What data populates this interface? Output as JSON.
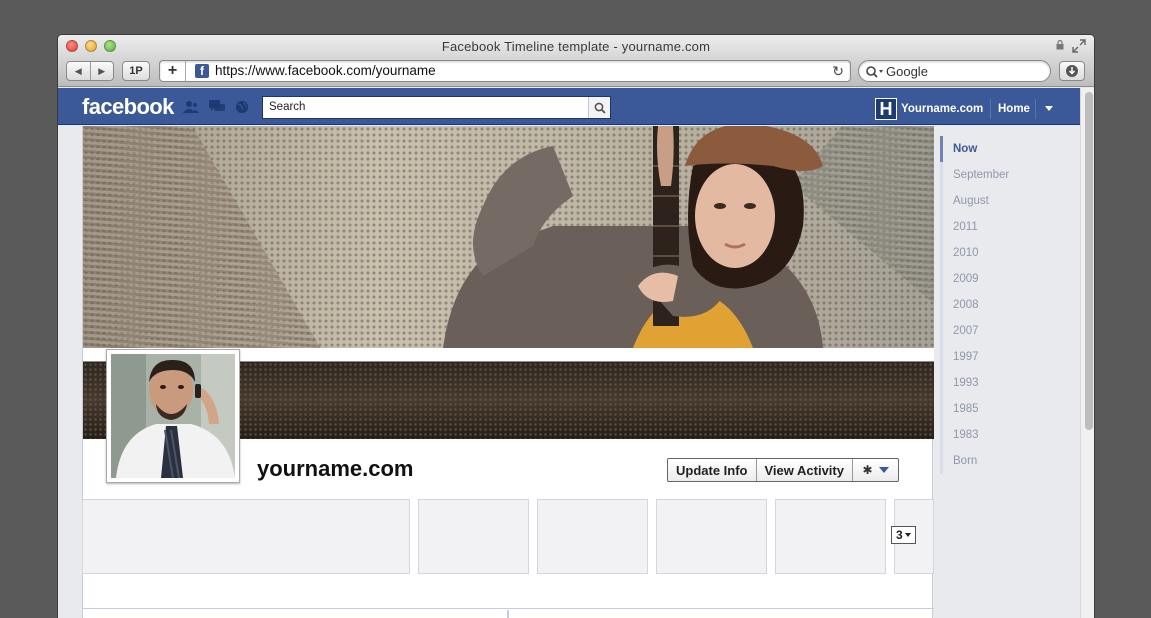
{
  "window": {
    "title": "Facebook Timeline template - yourname.com"
  },
  "browser": {
    "back_icon": "triangle-left-icon",
    "forward_icon": "triangle-right-icon",
    "extension_label": "1P",
    "add_label": "+",
    "url": "https://www.facebook.com/yourname",
    "reload_glyph": "↻",
    "search_engine": "Google"
  },
  "fb_header": {
    "logo": "facebook",
    "search_placeholder": "Search",
    "profile_icon_letter": "H",
    "profile_name": "Yourname.com",
    "home_label": "Home",
    "brand_color": "#3b5998"
  },
  "profile": {
    "name": "yourname.com",
    "actions": {
      "update_info": "Update Info",
      "view_activity": "View Activity",
      "settings_glyph": "✱"
    }
  },
  "tiles": {
    "overflow_count": "3"
  },
  "scrubber": {
    "items": [
      "Now",
      "September",
      "August",
      "2011",
      "2010",
      "2009",
      "2008",
      "2007",
      "1997",
      "1993",
      "1985",
      "1983",
      "Born"
    ],
    "active_index": 0
  }
}
